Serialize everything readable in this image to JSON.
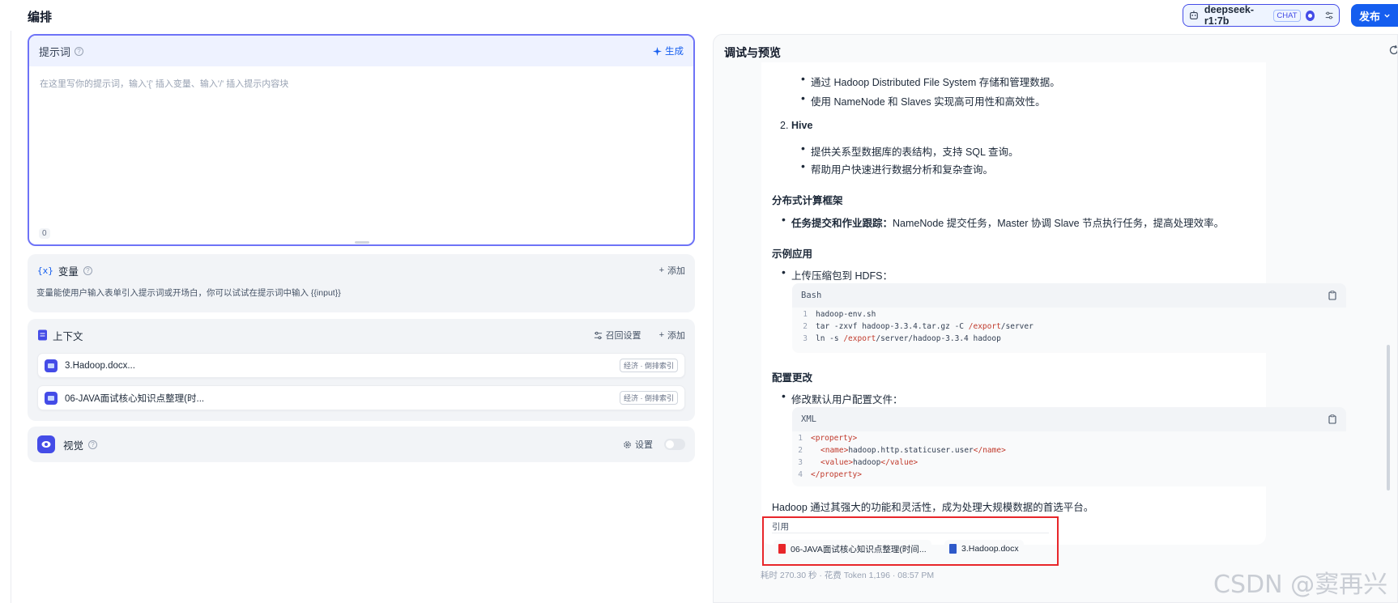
{
  "header": {
    "title": "编排",
    "model_name": "deepseek-r1:7b",
    "model_tag": "CHAT",
    "publish_label": "发布"
  },
  "prompt": {
    "label": "提示词",
    "generate_label": "生成",
    "placeholder": "在这里写你的提示词，输入'{' 插入变量、输入'/' 插入提示内容块",
    "char_count": "0"
  },
  "variables": {
    "title": "变量",
    "add_label": "添加",
    "description": "变量能使用户输入表单引入提示词或开场白，你可以试试在提示词中输入 {{input}}"
  },
  "context": {
    "title": "上下文",
    "retrieval_label": "召回设置",
    "add_label": "添加",
    "items": [
      {
        "name": "3.Hadoop.docx...",
        "tag": "经济 · 倒排索引"
      },
      {
        "name": "06-JAVA面试核心知识点整理(时...",
        "tag": "经济 · 倒排索引"
      }
    ]
  },
  "vision": {
    "title": "视觉",
    "settings_label": "设置"
  },
  "preview": {
    "title": "调试与预览",
    "lines": {
      "hdfs_1": "通过 Hadoop Distributed File System 存储和管理数据。",
      "hdfs_2": "使用 NameNode 和 Slaves 实现高可用性和高效性。",
      "hive_num": "2.",
      "hive": "Hive",
      "hive_1": "提供关系型数据库的表结构，支持 SQL 查询。",
      "hive_2": "帮助用户快速进行数据分析和复杂查询。",
      "dist_title": "分布式计算框架",
      "dist_bold": "任务提交和作业跟踪：",
      "dist_rest": "NameNode 提交任务，Master 协调 Slave 节点执行任务，提高处理效率。",
      "example_title": "示例应用",
      "example_1": "上传压缩包到 HDFS：",
      "config_title": "配置更改",
      "config_1": "修改默认用户配置文件：",
      "conclusion": "Hadoop 通过其强大的功能和灵活性，成为处理大规模数据的首选平台。"
    },
    "code_bash": {
      "lang": "Bash",
      "lines": [
        {
          "n": "1",
          "a": "hadoop-env.sh",
          "b": "",
          "c": "",
          "d": ""
        },
        {
          "n": "2",
          "a": "tar -zxvf hadoop-3.3.4.tar.gz -C ",
          "b": "/export",
          "c": "/server",
          "d": ""
        },
        {
          "n": "3",
          "a": "ln -s ",
          "b": "/export",
          "c": "/server/hadoop-3.3.4 hadoop",
          "d": ""
        }
      ]
    },
    "code_xml": {
      "lang": "XML",
      "lines": [
        {
          "n": "1",
          "open": "<property>",
          "text": "",
          "close": ""
        },
        {
          "n": "2",
          "open": "<name>",
          "text": "hadoop.http.staticuser.user",
          "close": "</name>"
        },
        {
          "n": "3",
          "open": "<value>",
          "text": "hadoop",
          "close": "</value>"
        },
        {
          "n": "4",
          "open": "</property>",
          "text": "",
          "close": ""
        }
      ]
    },
    "citations_label": "引用",
    "citations": [
      {
        "name": "06-JAVA面试核心知识点整理(时间..."
      },
      {
        "name": "3.Hadoop.docx"
      }
    ],
    "meta": "耗时 270.30 秒 · 花费 Token 1,196 · 08:57 PM"
  },
  "watermark": "CSDN @窦再兴",
  "colors": {
    "accent": "#155eef",
    "indigo": "#444ce7",
    "highlight_box": "#e8262a"
  }
}
